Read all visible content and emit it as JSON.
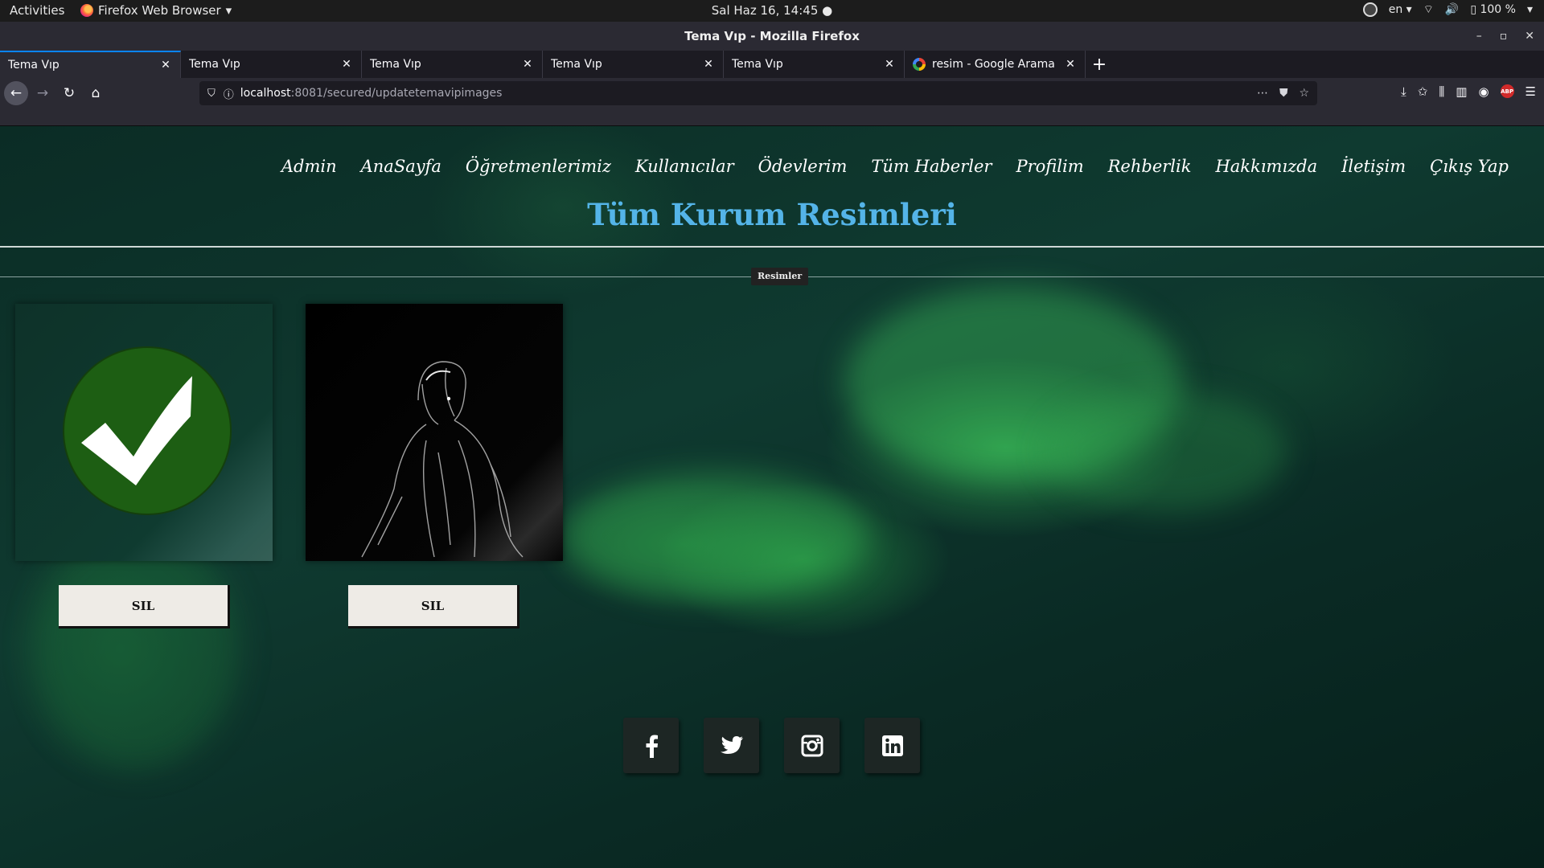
{
  "system_bar": {
    "activities": "Activities",
    "app_name": "Firefox Web Browser",
    "clock": "Sal Haz 16, 14:45",
    "language": "en",
    "battery": "100 %"
  },
  "window": {
    "title": "Tema Vıp - Mozilla Firefox"
  },
  "tabs": [
    {
      "label": "Tema Vıp"
    },
    {
      "label": "Tema Vıp"
    },
    {
      "label": "Tema Vıp"
    },
    {
      "label": "Tema Vıp"
    },
    {
      "label": "Tema Vıp"
    },
    {
      "label": "resim - Google Arama"
    }
  ],
  "address_bar": {
    "host": "localhost",
    "path": ":8081/secured/updatetemavipimages"
  },
  "site": {
    "nav": [
      "Admin",
      "AnaSayfa",
      "Öğretmenlerimiz",
      "Kullanıcılar",
      "Ödevlerim",
      "Tüm Haberler",
      "Profilim",
      "Rehberlik",
      "Hakkımızda",
      "İletişim",
      "Çıkış Yap"
    ],
    "title": "Tüm Kurum Resimleri",
    "section_label": "Resimler",
    "images": [
      {
        "name": "checkmark-image",
        "delete_label": "SIL"
      },
      {
        "name": "dark-figure-image",
        "delete_label": "SIL"
      }
    ],
    "social": [
      "facebook-icon",
      "twitter-icon",
      "instagram-icon",
      "linkedin-icon"
    ]
  },
  "colors": {
    "title_blue": "#54b4e8",
    "check_green": "#1d5e13",
    "tab_accent": "#0a84ff"
  }
}
